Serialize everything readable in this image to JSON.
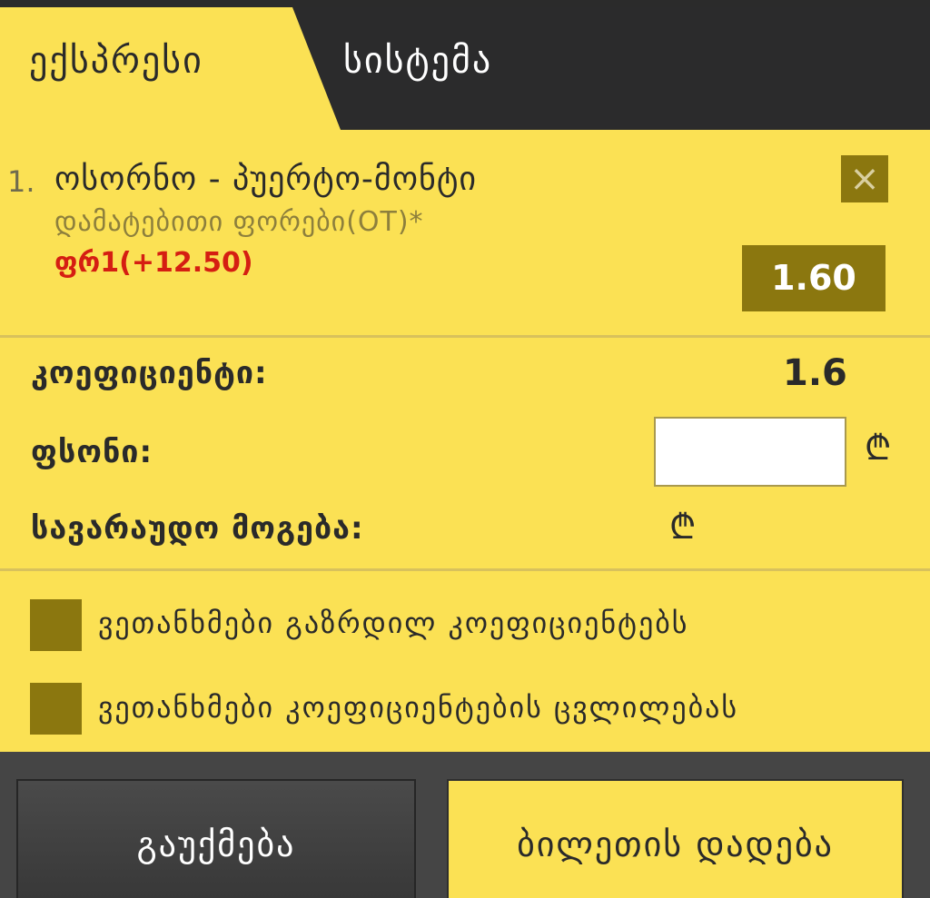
{
  "tabs": {
    "express": "ექსპრესი",
    "system": "სისტემა"
  },
  "bet": {
    "number": "1.",
    "match": "ოსორნო - პუერტო-მონტი",
    "market": "დამატებითი ფორები(OT)*",
    "pick": "ფრ1(+12.50)",
    "close": "×",
    "odds": "1.60"
  },
  "summary": {
    "coef_label": "კოეფიციენტი:",
    "coef_value": "1.6",
    "stake_label": "ფსონი:",
    "stake_value": "",
    "winnings_label": "სავარაუდო მოგება:",
    "currency": "₾"
  },
  "options": {
    "accept_increased": "ვეთანხმები გაზრდილ კოეფიციენტებს",
    "accept_changes": "ვეთანხმები კოეფიციენტების ცვლილებას"
  },
  "buttons": {
    "cancel": "გაუქმება",
    "place": "ბილეთის დადება"
  },
  "colors": {
    "yellow": "#fbe154",
    "olive": "#8b770f",
    "dark": "#2b2b2c",
    "red": "#d51e12"
  }
}
